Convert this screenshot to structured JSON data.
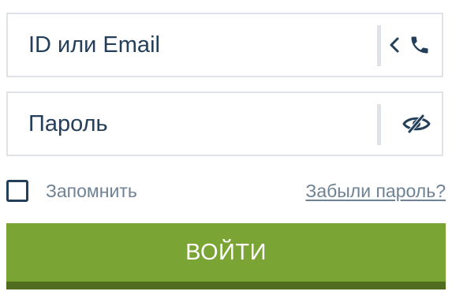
{
  "login": {
    "placeholder": "ID или Email",
    "icons": [
      "chevron-left-icon",
      "phone-icon"
    ]
  },
  "password": {
    "placeholder": "Пароль",
    "icon": "eye-crossed-icon"
  },
  "remember": {
    "label": "Запомнить",
    "checked": false
  },
  "forgot_link": "Забыли пароль?",
  "submit_label": "ВОЙТИ",
  "colors": {
    "text": "#243f5a",
    "muted": "#6f8294",
    "border": "#dfe3e7",
    "button": "#7aa434",
    "button_shadow": "#4f6c1f"
  }
}
